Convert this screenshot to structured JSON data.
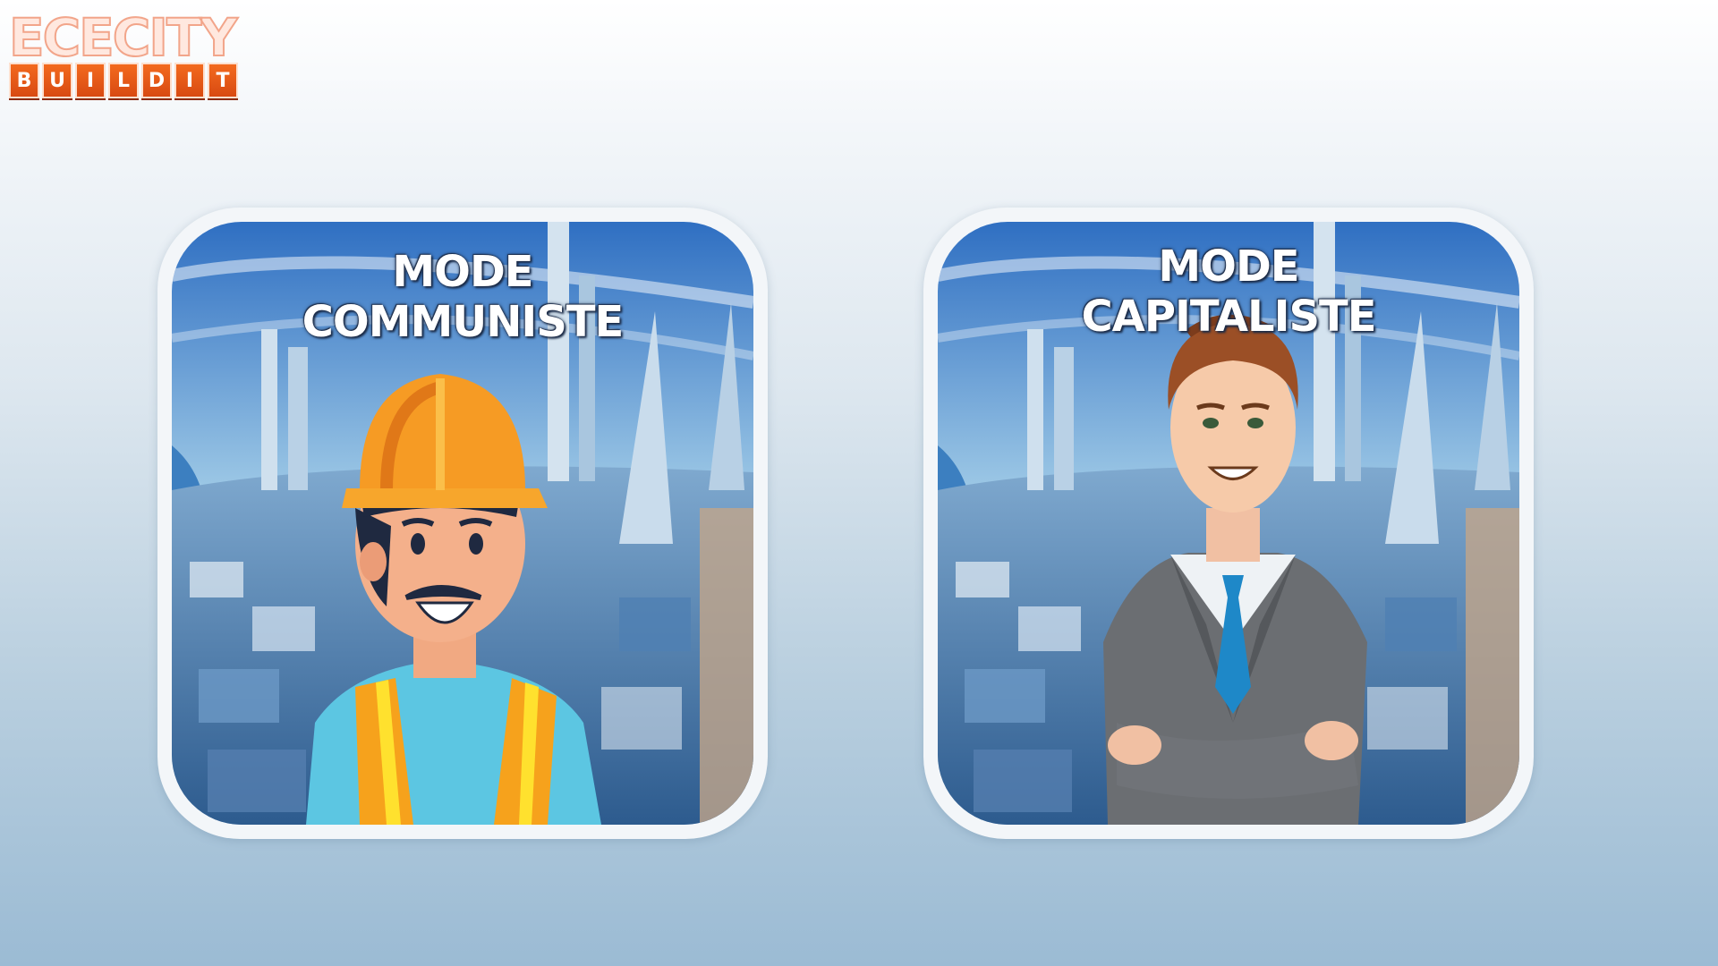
{
  "logo": {
    "title": "ECECITY",
    "subtitle_letters": [
      "B",
      "U",
      "I",
      "L",
      "D",
      "I",
      "T"
    ]
  },
  "modes": [
    {
      "line1": "MODE",
      "line2": "COMMUNISTE",
      "character": "construction-worker"
    },
    {
      "line1": "MODE",
      "line2": "CAPITALISTE",
      "character": "businessman"
    }
  ],
  "colors": {
    "logo_orange": "#e8581a",
    "card_border": "#f3f6f9",
    "sky_blue": "#3b7bc4"
  }
}
